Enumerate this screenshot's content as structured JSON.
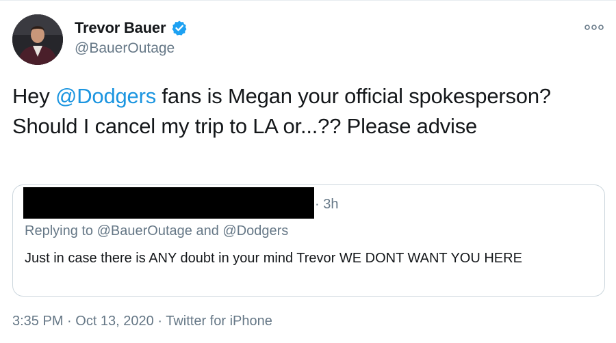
{
  "author": {
    "display_name": "Trevor Bauer",
    "handle": "@BauerOutage",
    "verified": true
  },
  "tweet": {
    "text_prefix": "Hey ",
    "mention": "@Dodgers",
    "text_suffix": " fans is Megan your official spokesperson? Should I cancel my trip to LA or...?? Please advise"
  },
  "quoted_tweet": {
    "time_ago": "· 3h",
    "replying_prefix": "Replying to ",
    "replying_handle_1": "@BauerOutage",
    "replying_and": " and ",
    "replying_handle_2": "@Dodgers",
    "body": "Just in case there is ANY doubt in your mind Trevor WE DONT WANT YOU HERE"
  },
  "meta": {
    "time": "3:35 PM",
    "separator_1": " · ",
    "date": "Oct 13, 2020",
    "separator_2": " · ",
    "source": "Twitter for iPhone"
  },
  "colors": {
    "link": "#1b95e0",
    "secondary_text": "#657786",
    "verified_badge": "#1da1f2",
    "border": "#ccd6dd"
  },
  "icons": {
    "more": "more-dots-icon",
    "verified": "verified-badge-icon"
  }
}
